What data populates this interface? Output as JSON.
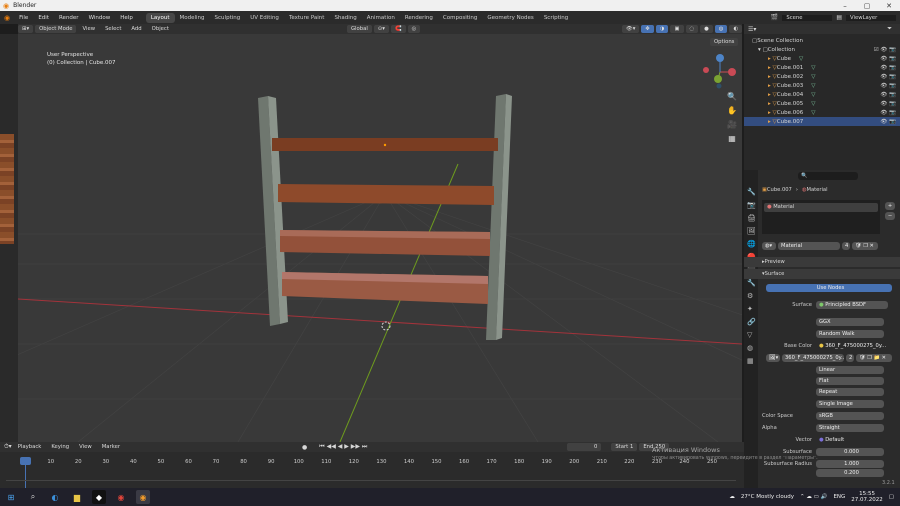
{
  "app": {
    "title": "Blender"
  },
  "menu": [
    "File",
    "Edit",
    "Render",
    "Window",
    "Help"
  ],
  "workspaces": [
    "Layout",
    "Modeling",
    "Sculpting",
    "UV Editing",
    "Texture Paint",
    "Shading",
    "Animation",
    "Rendering",
    "Compositing",
    "Geometry Nodes",
    "Scripting"
  ],
  "scene": {
    "name": "Scene",
    "view_layer": "ViewLayer"
  },
  "viewport": {
    "mode": "Object Mode",
    "menus": [
      "View",
      "Select",
      "Add",
      "Object"
    ],
    "transform": "Global",
    "options": "Options",
    "view_name": "User Perspective",
    "collection_info": "(0) Collection | Cube.007"
  },
  "outliner": {
    "root": "Scene Collection",
    "collection": "Collection",
    "items": [
      "Cube",
      "Cube.001",
      "Cube.002",
      "Cube.003",
      "Cube.004",
      "Cube.005",
      "Cube.006",
      "Cube.007"
    ]
  },
  "properties": {
    "breadcrumb_object": "Cube.007",
    "breadcrumb_material": "Material",
    "slot": "Material",
    "material_name": "Material",
    "users": "4",
    "preview": "Preview",
    "surface_panel": "Surface",
    "use_nodes": "Use Nodes",
    "surface_label": "Surface",
    "surface_value": "Principled BSDF",
    "distribution": "GGX",
    "subsurface_method": "Random Walk",
    "base_color_label": "Base Color",
    "base_color_value": "360_F_475000275_0y...",
    "image_name": "360_F_475000275_0y...",
    "image_users": "2",
    "interpolation": "Linear",
    "projection": "Flat",
    "extension": "Repeat",
    "source": "Single Image",
    "color_space_label": "Color Space",
    "color_space": "sRGB",
    "alpha_label": "Alpha",
    "alpha": "Straight",
    "vector_label": "Vector",
    "vector": "Default",
    "subsurface_label": "Subsurface",
    "subsurface": "0.000",
    "subsurface_radius_label": "Subsurface Radius",
    "radius_1": "1.000",
    "radius_2": "0.200"
  },
  "timeline": {
    "menus": [
      "Playback",
      "Keying",
      "View",
      "Marker"
    ],
    "current_frame": "0",
    "start_label": "Start",
    "start": "1",
    "end_label": "End",
    "end": "250",
    "ticks": [
      "0",
      "10",
      "20",
      "30",
      "40",
      "50",
      "60",
      "70",
      "80",
      "90",
      "100",
      "110",
      "120",
      "130",
      "140",
      "150",
      "160",
      "170",
      "180",
      "190",
      "200",
      "210",
      "220",
      "230",
      "240",
      "250"
    ]
  },
  "watermark": {
    "line1": "Активация Windows",
    "line2": "Чтобы активировать Windows, перейдите в раздел \"Параметры\"."
  },
  "version": "3.2.1",
  "taskbar": {
    "weather": "27°C Mostly cloudy",
    "language": "ENG",
    "time": "15:55",
    "date": "27.07.2022"
  },
  "colors": {
    "accent": "#4772b3",
    "header": "#303030",
    "viewport_bg": "#393939",
    "x_axis": "#a3333b",
    "y_axis": "#6e9b1e"
  }
}
